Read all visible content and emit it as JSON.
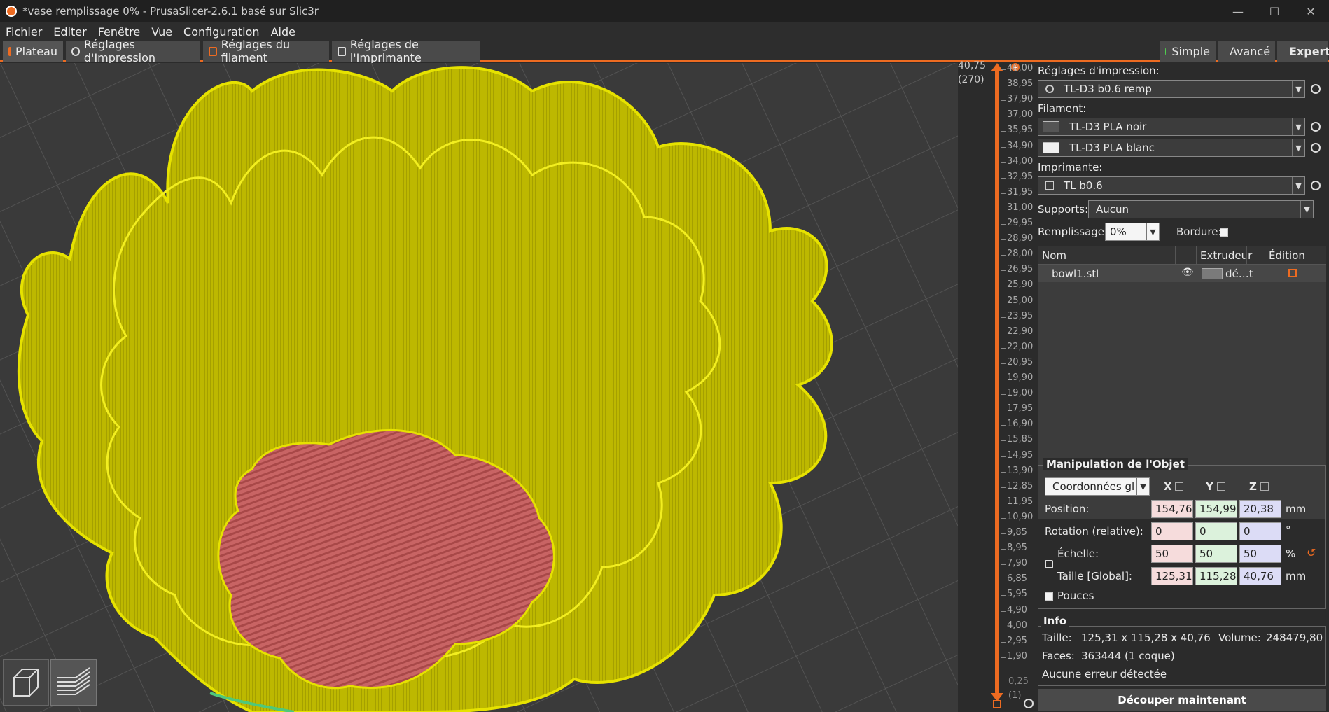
{
  "window": {
    "title": "*vase remplissage 0% - PrusaSlicer-2.6.1 basé sur Slic3r",
    "min_btn": "—",
    "max_btn": "☐",
    "close_btn": "✕"
  },
  "menu": [
    "Fichier",
    "Editer",
    "Fenêtre",
    "Vue",
    "Configuration",
    "Aide"
  ],
  "tabs": [
    "Plateau",
    "Réglages d'Impression",
    "Réglages du filament",
    "Réglages de l'Imprimante"
  ],
  "modes": [
    {
      "label": "Simple",
      "color": "#4fd14f"
    },
    {
      "label": "Avancé",
      "color": "#e8c81a"
    },
    {
      "label": "Expert",
      "color": "#e02020"
    }
  ],
  "slider": {
    "top_value": "40,75",
    "top_layer": "(270)",
    "bottom_value": "0,25",
    "bottom_layer": "(1)",
    "ticks": [
      "40,00",
      "38,95",
      "37,90",
      "37,00",
      "35,95",
      "34,90",
      "34,00",
      "32,95",
      "31,95",
      "31,00",
      "29,95",
      "28,90",
      "28,00",
      "26,95",
      "25,90",
      "25,00",
      "23,95",
      "22,90",
      "22,00",
      "20,95",
      "19,90",
      "19,00",
      "17,95",
      "16,90",
      "15,85",
      "14,95",
      "13,90",
      "12,85",
      "11,95",
      "10,90",
      "9,85",
      "8,95",
      "7,90",
      "6,85",
      "5,95",
      "4,90",
      "4,00",
      "2,95",
      "1,90"
    ]
  },
  "sidebar": {
    "print_label": "Réglages d'impression:",
    "print_value": "TL-D3 b0.6 remp",
    "filament_label": "Filament:",
    "filament1": "TL-D3 PLA noir",
    "filament2": "TL-D3 PLA blanc",
    "printer_label": "Imprimante:",
    "printer_value": "TL b0.6",
    "supports_label": "Supports:",
    "supports_value": "Aucun",
    "infill_label": "Remplissage:",
    "infill_value": "0%",
    "brim_label": "Bordure:",
    "list_headers": {
      "name": "Nom",
      "extruder": "Extrudeur",
      "edit": "Édition"
    },
    "object": {
      "name": "bowl1.stl",
      "extruder": "dé…t"
    }
  },
  "manip": {
    "title": "Manipulation de l'Objet",
    "coords": "Coordonnées glo",
    "x": "X",
    "y": "Y",
    "z": "Z",
    "position_label": "Position:",
    "position": [
      "154,76",
      "154,99",
      "20,38"
    ],
    "pos_unit": "mm",
    "rotation_label": "Rotation (relative):",
    "rotation": [
      "0",
      "0",
      "0"
    ],
    "rot_unit": "°",
    "scale_label": "Échelle:",
    "scale": [
      "50",
      "50",
      "50"
    ],
    "scale_unit": "%",
    "size_label": "Taille [Global]:",
    "size": [
      "125,31",
      "115,28",
      "40,76"
    ],
    "size_unit": "mm",
    "inches_label": "Pouces"
  },
  "info": {
    "title": "Info",
    "size_label": "Taille:",
    "size": "125,31 x 115,28 x 40,76",
    "volume_label": "Volume:",
    "volume": "248479,80",
    "faces_label": "Faces:",
    "faces": "363444 (1 coque)",
    "errors": "Aucune erreur détectée"
  },
  "slice_button": "Découper maintenant",
  "colors": {
    "accent": "#ed6b21",
    "model": "#c8c400",
    "infill": "#c86464"
  }
}
